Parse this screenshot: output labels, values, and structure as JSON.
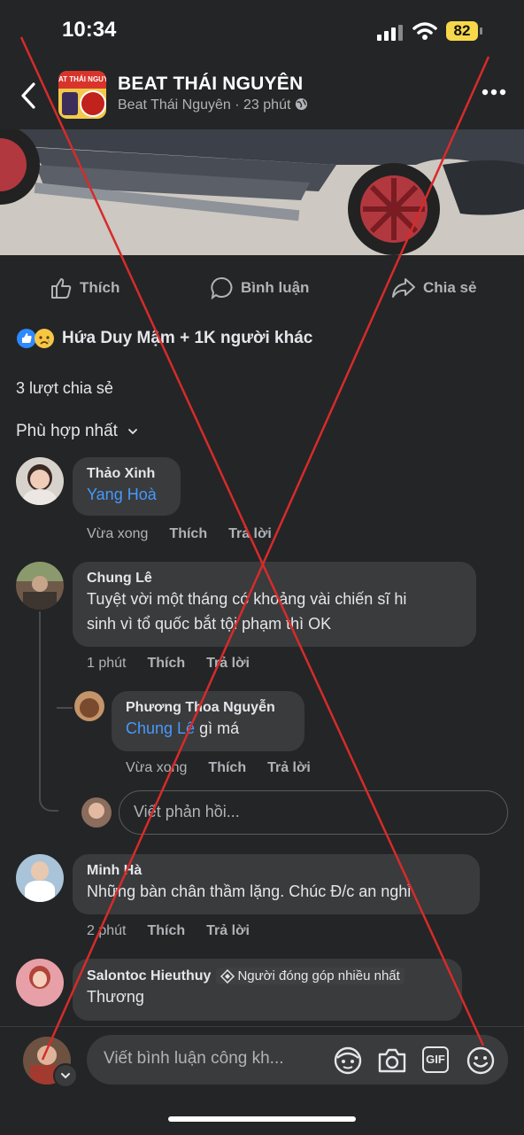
{
  "status": {
    "time": "10:34",
    "battery": "82"
  },
  "header": {
    "title": "BEAT THÁI NGUYÊN",
    "page_name": "Beat Thái Nguyên",
    "time": "23 phút",
    "avatar_text": "AT THÁI NGUY"
  },
  "actions": {
    "like": "Thích",
    "comment": "Bình luận",
    "share": "Chia sẻ"
  },
  "reactions": {
    "text": "Hứa Duy Mậm + 1K người khác"
  },
  "shares": "3 lượt chia sẻ",
  "sort": {
    "label": "Phù hợp nhất"
  },
  "comments": [
    {
      "name": "Thảo Xinh",
      "mention": "Yang Hoà",
      "text": "",
      "time": "Vừa xong",
      "like": "Thích",
      "reply": "Trả lời"
    },
    {
      "name": "Chung Lê",
      "text_line1": "Tuyệt vời một tháng có khoảng vài chiến sĩ hi",
      "text_line2": "sinh vì tổ quốc bắt tội phạm thì OK",
      "time": "1 phút",
      "like": "Thích",
      "reply": "Trả lời"
    },
    {
      "name": "Phương Thoa Nguyễn",
      "mention": "Chung Lê",
      "text": " gì má",
      "time": "Vừa xong",
      "like": "Thích",
      "reply": "Trả lời"
    },
    {
      "name": "Minh Hà",
      "text": "Những bàn chân thầm lặng. Chúc Đ/c an nghỉ",
      "time": "2 phút",
      "like": "Thích",
      "reply": "Trả lời"
    },
    {
      "name": "Salontoc Hieuthuy",
      "badge": "Người đóng góp nhiều nhất",
      "text": "Thương"
    }
  ],
  "reply_placeholder": "Viết phản hồi...",
  "comment_placeholder": "Viết bình luận công kh...",
  "gif_label": "GIF",
  "icons": [
    "back-icon",
    "more-icon",
    "globe-icon",
    "like-icon",
    "comment-icon",
    "share-icon",
    "chevron-down-icon",
    "avatar-sticker-icon",
    "camera-icon",
    "gif-icon",
    "emoji-icon"
  ],
  "colors": {
    "background": "#242526",
    "bubble": "#3a3b3c",
    "mention": "#4599ff",
    "overlay_x": "#d62b2b",
    "battery": "#f7d84a"
  }
}
